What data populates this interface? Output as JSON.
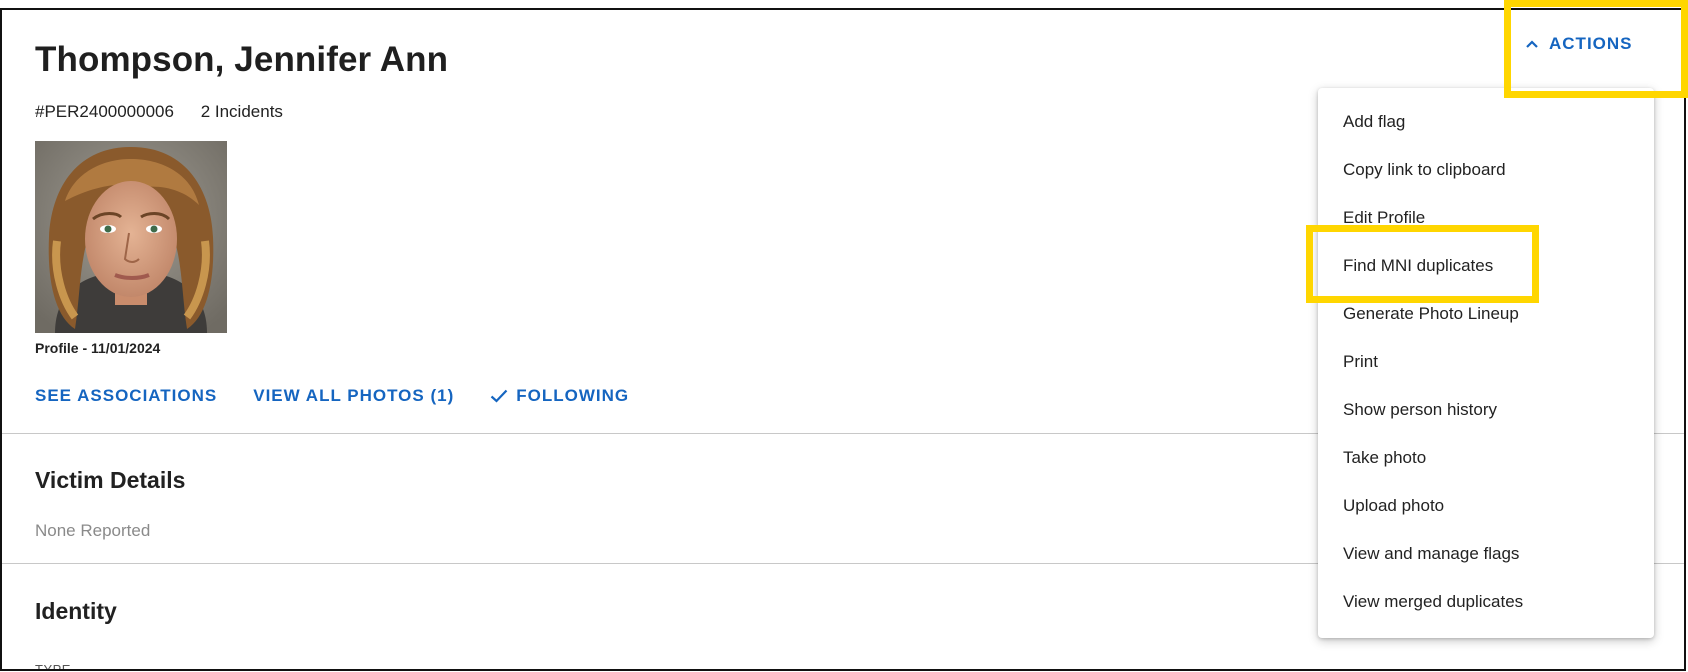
{
  "person": {
    "name": "Thompson, Jennifer Ann",
    "id": "#PER2400000006",
    "incidents": "2 Incidents",
    "photo_caption": "Profile - 11/01/2024"
  },
  "links": {
    "associations": "SEE ASSOCIATIONS",
    "photos": "VIEW ALL PHOTOS (1)",
    "following": "FOLLOWING"
  },
  "sections": {
    "victim_title": "Victim Details",
    "victim_value": "None Reported",
    "identity_title": "Identity",
    "identity_type_label": "TYPE"
  },
  "actions": {
    "label": "ACTIONS",
    "menu": [
      "Add flag",
      "Copy link to clipboard",
      "Edit Profile",
      "Find MNI duplicates",
      "Generate Photo Lineup",
      "Print",
      "Show person history",
      "Take photo",
      "Upload photo",
      "View and manage flags",
      "View merged duplicates"
    ]
  },
  "colors": {
    "accent": "#1565c0",
    "highlight": "#ffd600"
  }
}
